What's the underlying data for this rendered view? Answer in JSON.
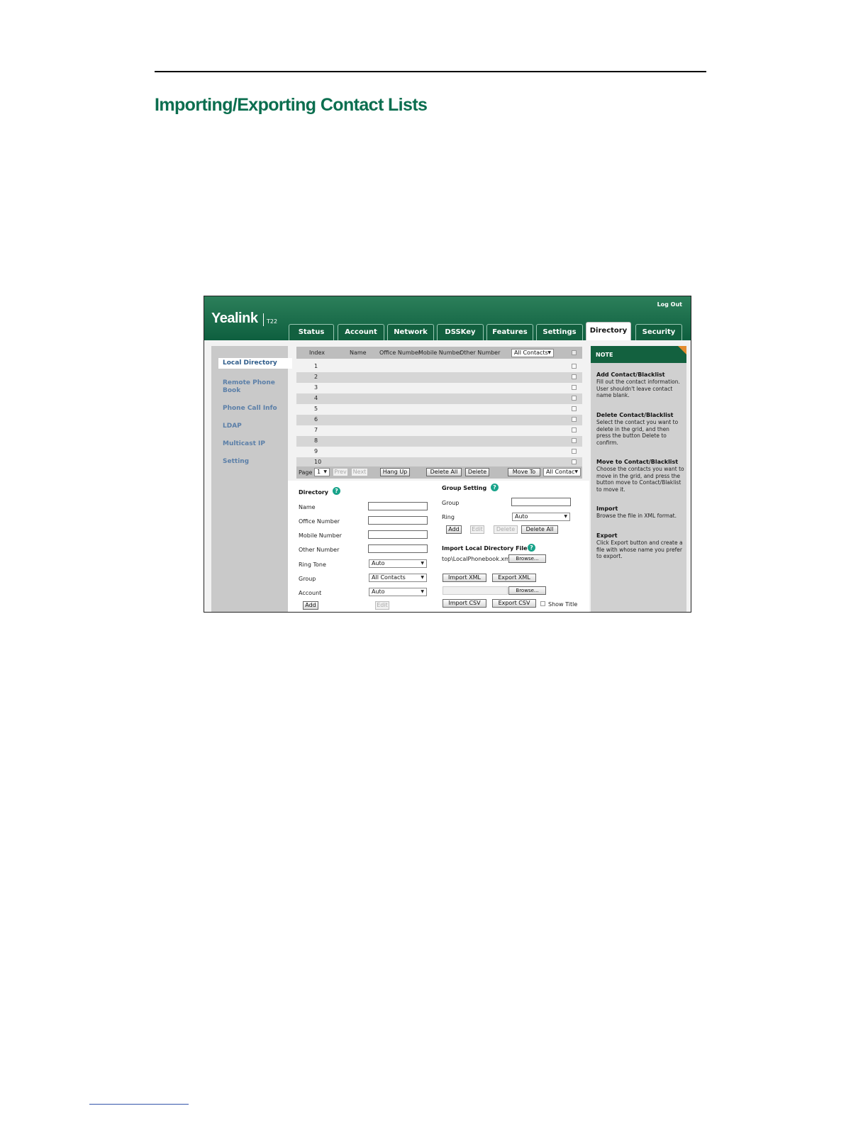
{
  "document": {
    "heading": "Importing/Exporting Contact Lists"
  },
  "app": {
    "brand": "Yealink",
    "model": "T22",
    "logout": "Log Out",
    "tabs": [
      "Status",
      "Account",
      "Network",
      "DSSKey",
      "Features",
      "Settings",
      "Directory",
      "Security"
    ],
    "active_tab": "Directory"
  },
  "sidebar": {
    "items": [
      "Local Directory",
      "Remote Phone Book",
      "Phone Call Info",
      "LDAP",
      "Multicast IP",
      "Setting"
    ],
    "active": "Local Directory"
  },
  "grid": {
    "columns": [
      "Index",
      "Name",
      "Office Number",
      "Mobile Number",
      "Other Number"
    ],
    "group_filter": "All Contacts",
    "rows": [
      "1",
      "2",
      "3",
      "4",
      "5",
      "6",
      "7",
      "8",
      "9",
      "10"
    ],
    "footer": {
      "page_label": "Page",
      "page_value": "1",
      "prev": "Prev",
      "next": "Next",
      "hang_up": "Hang Up",
      "delete_all": "Delete All",
      "delete": "Delete",
      "move_to": "Move To",
      "move_target": "All Contac"
    }
  },
  "directory_form": {
    "title": "Directory",
    "name_label": "Name",
    "office_label": "Office Number",
    "mobile_label": "Mobile Number",
    "other_label": "Other Number",
    "ring_tone_label": "Ring Tone",
    "ring_tone_value": "Auto",
    "group_label": "Group",
    "group_value": "All Contacts",
    "account_label": "Account",
    "account_value": "Auto",
    "add": "Add",
    "edit": "Edit"
  },
  "group_setting": {
    "title": "Group Setting",
    "group_label": "Group",
    "ring_label": "Ring",
    "ring_value": "Auto",
    "add": "Add",
    "edit": "Edit",
    "delete": "Delete",
    "delete_all": "Delete All"
  },
  "import_section": {
    "title": "Import Local Directory File",
    "file_path": "top\\LocalPhonebook.xml",
    "browse": "Browse...",
    "import_xml": "Import XML",
    "export_xml": "Export XML",
    "browse2": "Browse...",
    "import_csv": "Import CSV",
    "export_csv": "Export CSV",
    "show_title": "Show Title"
  },
  "note": {
    "title": "NOTE",
    "sections": [
      {
        "heading": "Add Contact/Blacklist",
        "text": "Fill out the contact information. User shouldn't leave contact name blank."
      },
      {
        "heading": "Delete Contact/Blacklist",
        "text": "Select the contact you want to delete in the grid, and then press the button Delete to confirm."
      },
      {
        "heading": "Move to Contact/Blacklist",
        "text": "Choose the contacts you want to move in the grid, and press the button move to Contact/Blaklist to move it."
      },
      {
        "heading": "Import",
        "text": "Browse the file in XML format."
      },
      {
        "heading": "Export",
        "text": "Click Export button and create a file with whose name you prefer to export."
      }
    ]
  },
  "colors": {
    "heading_green": "#0b6e4f",
    "banner_green": "#0e5f3f",
    "note_accent": "#e38b2e",
    "help_icon": "#18a38a",
    "sidebar_link": "#5b7fa8"
  }
}
